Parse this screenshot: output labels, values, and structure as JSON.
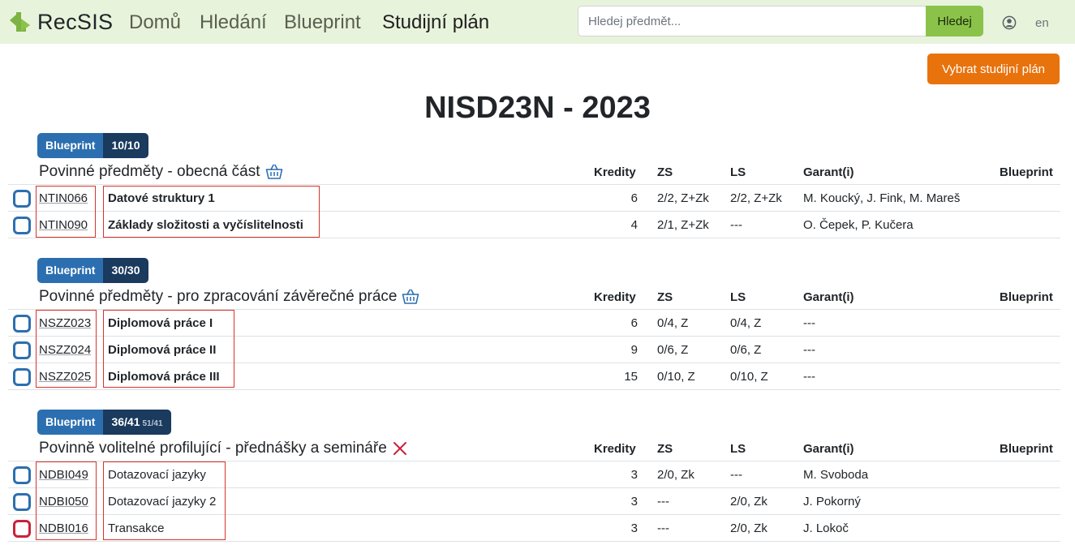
{
  "nav": {
    "brand": "RecSIS",
    "links": [
      "Domů",
      "Hledání",
      "Blueprint",
      "Studijní plán"
    ],
    "search_placeholder": "Hledej předmět...",
    "search_button": "Hledej",
    "user_icon": "user-circle-icon",
    "lang": "en"
  },
  "header": {
    "choose_plan": "Vybrat studijní plán",
    "title": "NISD23N - 2023"
  },
  "columns": {
    "credits": "Kredity",
    "zs": "ZS",
    "ls": "LS",
    "garant": "Garant(i)",
    "blueprint": "Blueprint"
  },
  "colors": {
    "navbar": "#e8f3dc",
    "search_button": "#8bc34a",
    "plan_button": "#e8730d",
    "badge": "#2c6fb0",
    "badge_dark": "#1a3a5e",
    "checkbox": "#2c6fb0",
    "checkbox_alert": "#c8233a",
    "remove": "#c8233a"
  },
  "sections": [
    {
      "badge_label": "Blueprint",
      "badge_count": "10/10",
      "badge_sub": "",
      "title": "Povinné předměty - obecná část",
      "icon": "basket-icon",
      "rows": [
        {
          "code": "NTIN066",
          "name": "Datové struktury 1",
          "credits": "6",
          "zs": "2/2, Z+Zk",
          "ls": "2/2, Z+Zk",
          "garant": "M. Koucký, J. Fink, M. Mareš",
          "bold": true,
          "alert": false
        },
        {
          "code": "NTIN090",
          "name": "Základy složitosti a vyčíslitelnosti",
          "credits": "4",
          "zs": "2/1, Z+Zk",
          "ls": "---",
          "garant": "O. Čepek, P. Kučera",
          "bold": true,
          "alert": false
        }
      ]
    },
    {
      "badge_label": "Blueprint",
      "badge_count": "30/30",
      "badge_sub": "",
      "title": "Povinné předměty - pro zpracování závěrečné práce",
      "icon": "basket-icon",
      "rows": [
        {
          "code": "NSZZ023",
          "name": "Diplomová práce I",
          "credits": "6",
          "zs": "0/4, Z",
          "ls": "0/4, Z",
          "garant": "---",
          "bold": true,
          "alert": false
        },
        {
          "code": "NSZZ024",
          "name": "Diplomová práce II",
          "credits": "9",
          "zs": "0/6, Z",
          "ls": "0/6, Z",
          "garant": "---",
          "bold": true,
          "alert": false
        },
        {
          "code": "NSZZ025",
          "name": "Diplomová práce III",
          "credits": "15",
          "zs": "0/10, Z",
          "ls": "0/10, Z",
          "garant": "---",
          "bold": true,
          "alert": false
        }
      ]
    },
    {
      "badge_label": "Blueprint",
      "badge_count": "36/41",
      "badge_sub": "51/41",
      "title": "Povinně volitelné profilující - přednášky a semináře",
      "icon": "close-icon",
      "rows": [
        {
          "code": "NDBI049",
          "name": "Dotazovací jazyky",
          "credits": "3",
          "zs": "2/0, Zk",
          "ls": "---",
          "garant": "M. Svoboda",
          "bold": false,
          "alert": false
        },
        {
          "code": "NDBI050",
          "name": "Dotazovací jazyky 2",
          "credits": "3",
          "zs": "---",
          "ls": "2/0, Zk",
          "garant": "J. Pokorný",
          "bold": false,
          "alert": false
        },
        {
          "code": "NDBI016",
          "name": "Transakce",
          "credits": "3",
          "zs": "---",
          "ls": "2/0, Zk",
          "garant": "J. Lokoč",
          "bold": false,
          "alert": true
        }
      ]
    }
  ]
}
